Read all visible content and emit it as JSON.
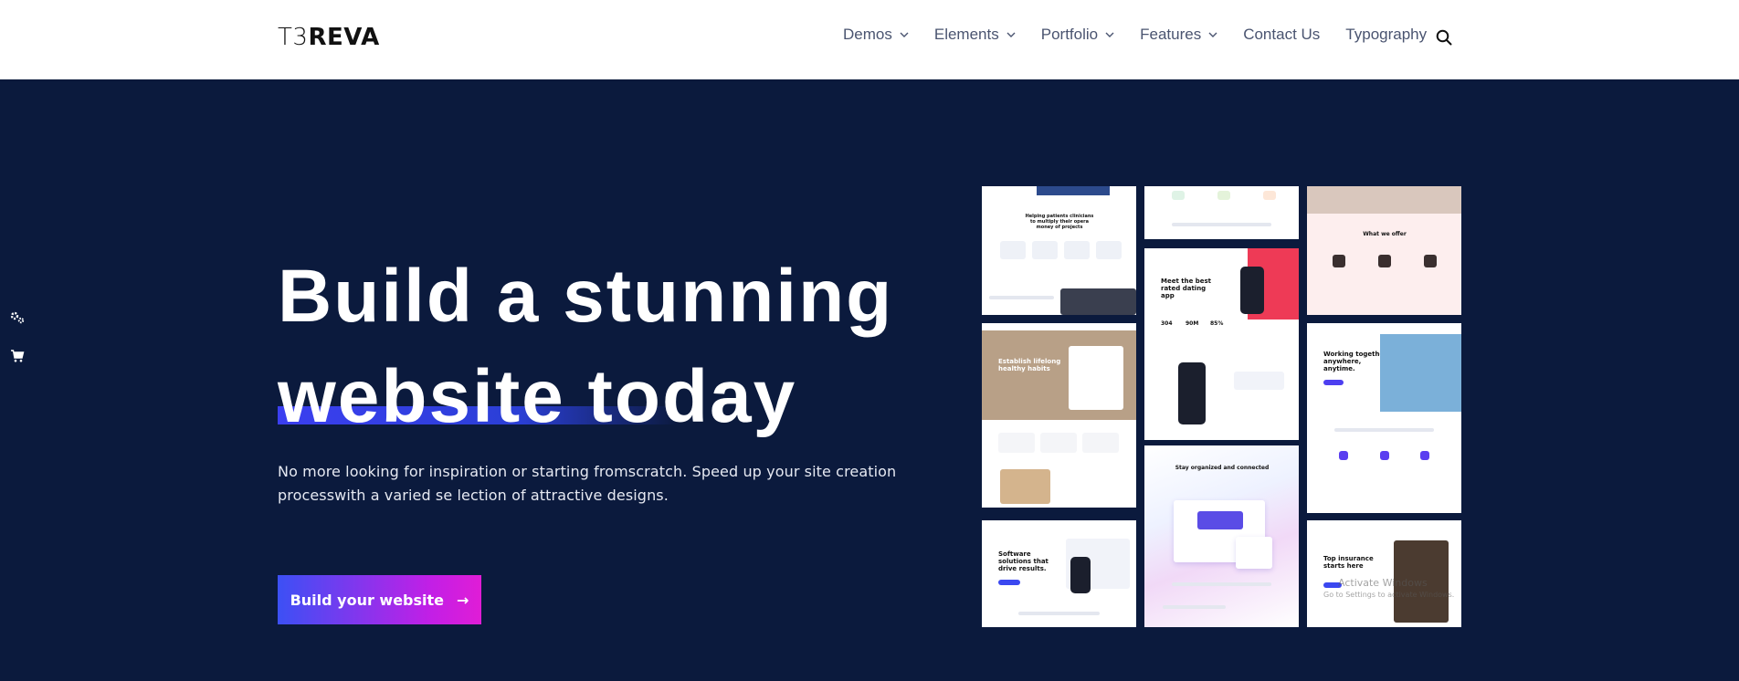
{
  "header": {
    "logo_thin": "T3",
    "logo_bold": "REVA",
    "nav": [
      {
        "label": "Demos",
        "has_dropdown": true
      },
      {
        "label": "Elements",
        "has_dropdown": true
      },
      {
        "label": "Portfolio",
        "has_dropdown": true
      },
      {
        "label": "Features",
        "has_dropdown": true
      },
      {
        "label": "Contact Us",
        "has_dropdown": false
      },
      {
        "label": "Typography",
        "has_dropdown": false
      }
    ],
    "search_icon": "search-icon"
  },
  "sidebar": {
    "icons": [
      "settings-icon",
      "cart-icon"
    ]
  },
  "hero": {
    "title_line1": "Build a stunning",
    "title_line2": "website today",
    "description": "No more looking for inspiration or starting fromscratch. Speed up your site creation processwith a varied se lection of attractive designs.",
    "cta_label": "Build your website",
    "cta_arrow": "→"
  },
  "gallery": {
    "thumb_texts": {
      "t1": "Helping patients clinicians to multiply their opera money of projects",
      "t3": "What we offer",
      "t4": "Meet the best rated dating app",
      "t4_stats": [
        "304",
        "90M",
        "85%"
      ],
      "t5": "Establish lifelong healthy habits",
      "t6": "Working together anywhere, anytime.",
      "t7": "Stay organized and connected",
      "t8": "Software solutions that drive results.",
      "t9": "Top insurance starts here",
      "watermark_line1": "Activate Windows",
      "watermark_line2": "Go to Settings to activate Windows."
    }
  },
  "colors": {
    "header_bg": "#ffffff",
    "hero_bg": "#0b1a3d",
    "cta_gradient_start": "#3c50f5",
    "cta_gradient_end": "#e01dd6",
    "underline": "#2b3fd6"
  }
}
